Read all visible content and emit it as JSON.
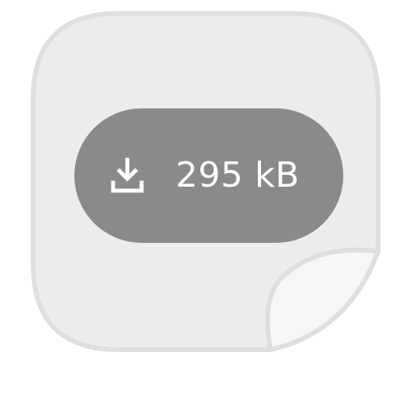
{
  "download": {
    "size_label": "295 kB",
    "icon": "download-icon"
  },
  "file": {
    "icon": "file-page-curl"
  },
  "colors": {
    "card_fill": "#ececec",
    "card_border": "#dedede",
    "chip": "#8a8a8a",
    "chip_text": "#ffffff"
  }
}
